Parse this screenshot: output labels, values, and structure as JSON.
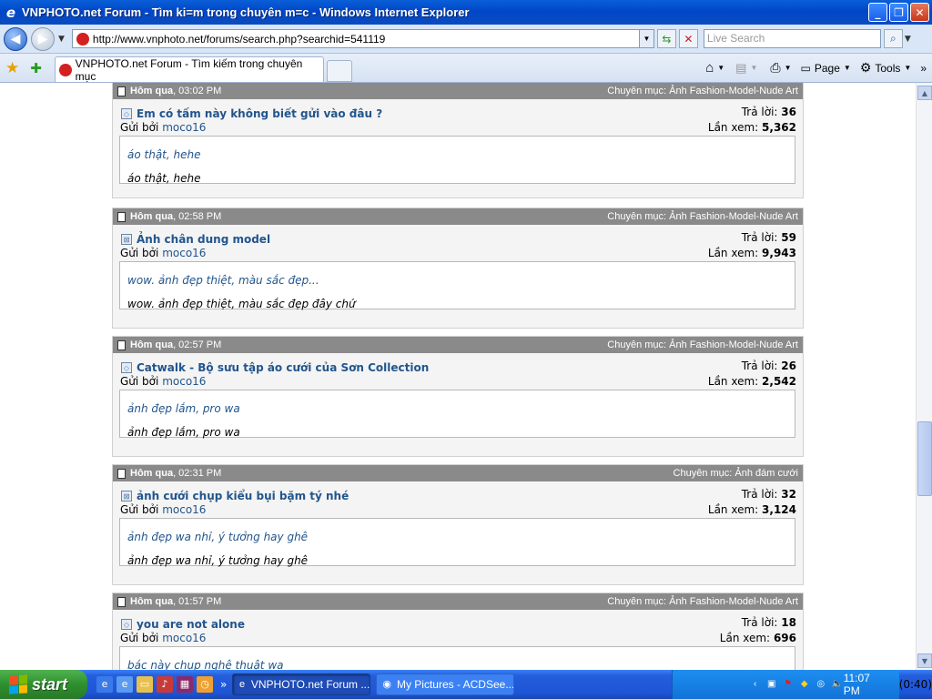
{
  "window": {
    "title": "VNPHOTO.net Forum - Tìm ki=m trong chuyên m=c - Windows Internet Explorer"
  },
  "address": {
    "url": "http://www.vnphoto.net/forums/search.php?searchid=541119",
    "search_placeholder": "Live Search"
  },
  "tab": {
    "title": "VNPHOTO.net Forum - Tìm kiếm trong chuyên mục"
  },
  "toolbar": {
    "page_label": "Page",
    "tools_label": "Tools"
  },
  "labels": {
    "by": "Gửi bởi",
    "replies": "Trả lời:",
    "views": "Lần xem:",
    "category_prefix": "Chuyên mục:"
  },
  "posts": [
    {
      "day": "Hôm qua",
      "time": ", 03:02 PM",
      "category": "Ảnh Fashion-Model-Nude Art",
      "title": "Em có tấm này không biết gửi vào đâu ?",
      "author": "moco16",
      "replies": "36",
      "views": "5,362",
      "preview_title": "áo thật, hehe",
      "preview_text": "áo thật, hehe"
    },
    {
      "day": "Hôm qua",
      "time": ", 02:58 PM",
      "category": "Ảnh Fashion-Model-Nude Art",
      "title": "Ảnh chân dung model",
      "author": "moco16",
      "replies": "59",
      "views": "9,943",
      "preview_title": "wow. ảnh đẹp thiệt, màu sắc đẹp...",
      "preview_text": "wow. ảnh đẹp thiệt, màu sắc đẹp đây chứ"
    },
    {
      "day": "Hôm qua",
      "time": ", 02:57 PM",
      "category": "Ảnh Fashion-Model-Nude Art",
      "title": "Catwalk - Bộ sưu tập áo cưới của Sơn Collection",
      "author": "moco16",
      "replies": "26",
      "views": "2,542",
      "preview_title": "ảnh đẹp lắm, pro wa",
      "preview_text": "ảnh đẹp lắm, pro wa"
    },
    {
      "day": "Hôm qua",
      "time": ", 02:31 PM",
      "category": "Ảnh đám cưới",
      "title": "ảnh cưới chụp kiểu bụi bặm tý nhé",
      "author": "moco16",
      "replies": "32",
      "views": "3,124",
      "preview_title": "ảnh đẹp wa nhỉ, ý tưởng hay ghê",
      "preview_text": "ảnh đẹp wa nhỉ, ý tưởng hay ghê"
    },
    {
      "day": "Hôm qua",
      "time": ", 01:57 PM",
      "category": "Ảnh Fashion-Model-Nude Art",
      "title": "you are not alone",
      "author": "moco16",
      "replies": "18",
      "views": "696",
      "preview_title": "bác này chụp nghệ thuật wa",
      "preview_text": ""
    }
  ],
  "taskbar": {
    "start_label": "start",
    "tasks": [
      {
        "label": "VNPHOTO.net Forum ..."
      },
      {
        "label": "My Pictures - ACDSee..."
      }
    ],
    "timer": "(0:40)",
    "clock": "11:07 PM"
  },
  "colors": {
    "title_bar": "#0046c8",
    "post_header": "#8a8a8a",
    "link": "#22558c",
    "taskbar": "#245edc",
    "start": "#2e8f2e"
  }
}
